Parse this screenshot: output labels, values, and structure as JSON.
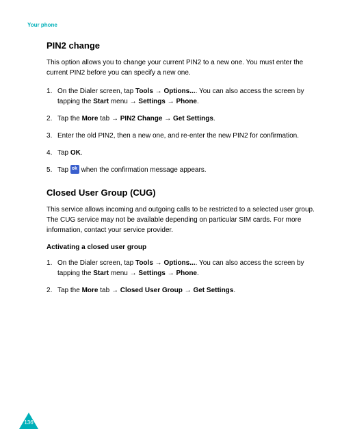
{
  "breadcrumb": "Your phone",
  "pin2": {
    "title": "PIN2 change",
    "intro": "This option allows you to change your current PIN2 to a new one. You must enter the current PIN2 before you can specify a new one.",
    "steps": {
      "s1a": "On the Dialer screen, tap ",
      "s1_tools": "Tools",
      "s1b": " → ",
      "s1_options": "Options...",
      "s1c": ". You can also access the screen by tapping the ",
      "s1_start": "Start",
      "s1d": " menu → ",
      "s1_settings": "Settings",
      "s1e": " → ",
      "s1_phone": "Phone",
      "s1f": ".",
      "s2a": "Tap the ",
      "s2_more": "More",
      "s2b": " tab → ",
      "s2_pin2": "PIN2 Change",
      "s2c": " → ",
      "s2_get": "Get Settings",
      "s2d": ".",
      "s3": "Enter the old PIN2, then a new one, and re-enter the new PIN2 for confirmation.",
      "s4a": "Tap ",
      "s4_ok": "OK",
      "s4b": ".",
      "s5a": "Tap ",
      "s5b": " when the confirmation message appears."
    }
  },
  "cug": {
    "title": "Closed User Group (CUG)",
    "intro": "This service allows incoming and outgoing calls to be restricted to a selected user group. The CUG service may not be available depending on particular SIM cards. For more information, contact your service provider.",
    "subhead": "Activating a closed user group",
    "steps": {
      "s1a": "On the Dialer screen, tap ",
      "s1_tools": "Tools",
      "s1b": " → ",
      "s1_options": "Options...",
      "s1c": ". You can also access the screen by tapping the ",
      "s1_start": "Start",
      "s1d": " menu → ",
      "s1_settings": "Settings",
      "s1e": " → ",
      "s1_phone": "Phone",
      "s1f": ".",
      "s2a": "Tap the ",
      "s2_more": "More",
      "s2b": " tab → ",
      "s2_cug": "Closed User Group",
      "s2c": " → ",
      "s2_get": "Get Settings",
      "s2d": "."
    }
  },
  "page_number": "136"
}
